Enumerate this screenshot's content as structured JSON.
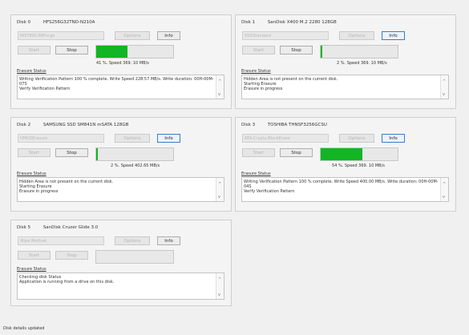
{
  "disks": [
    {
      "id": "0",
      "name": "HFS256G32TND-N210A",
      "method": "NIST800-88Purge",
      "options": "Options",
      "info": "Info",
      "start": "Start",
      "stop": "Stop",
      "progress": 41,
      "speed_text": "41 %. Speed  369. 10 MB/s",
      "status_label": "Erasure Status",
      "status_lines": [
        "Writing Verification Pattern 100 % complete. Write Speed  228.57 MB/s. Write duration: 00H-00M-07S",
        "Verify Verification Pattern",
        ""
      ],
      "scroll_up": "^",
      "scroll_down": "v"
    },
    {
      "id": "1",
      "name": "SanDisk X400 M.2 2280 128GB",
      "method": "SSDStandard",
      "options": "Options",
      "info": "Info",
      "start": "Start",
      "stop": "Stop",
      "progress": 2,
      "speed_text": "2 %. Speed  369. 10 MB/s",
      "status_label": "Erasure Status",
      "status_lines": [
        "Hidden Area is not present on the current disk.",
        "Starting Erasure",
        "Erasure in progress"
      ],
      "scroll_up": "^",
      "scroll_down": "v"
    },
    {
      "id": "2",
      "name": "SAMSUNG SSD SM841N mSATA 128GB",
      "method": "HMG5Erasure",
      "options": "Options",
      "info": "Info",
      "start": "Start",
      "stop": "Stop",
      "progress": 2,
      "speed_text": "2 %. Speed  402.65 MB/s",
      "status_label": "Erasure Status",
      "status_lines": [
        "Hidden Area is not present on the current disk.",
        "Starting Erasure",
        "Erasure in progress"
      ],
      "scroll_up": "^",
      "scroll_down": "v"
    },
    {
      "id": "3",
      "name": "TOSHIBA THNSF3256GCSU",
      "method": "ATA-Crypto-BlockErase",
      "options": "Options",
      "info": "Info",
      "start": "Start",
      "stop": "Stop",
      "progress": 54,
      "speed_text": "54 %. Speed  369. 10 MB/s",
      "status_label": "Erasure Status",
      "status_lines": [
        "Writing Verification Pattern 100 % complete. Write Speed  400.00 MB/s. Write duration: 00H-00M-04S",
        "Verify Verification Pattern",
        ""
      ],
      "scroll_up": "^",
      "scroll_down": "v"
    },
    {
      "id": "5",
      "name": "SanDisk Cruzer Glide 3.0",
      "method": "Wipe Method",
      "options": "Options",
      "info": "Info",
      "start": "Start",
      "stop": "Stop",
      "progress": 0,
      "speed_text": "",
      "status_label": "Erasure Status",
      "status_lines": [
        "Checking disk Status",
        "Application is running from a drive on this disk.",
        ""
      ],
      "scroll_up": "^",
      "scroll_down": "v"
    }
  ],
  "footer": "Disk details updated",
  "colors": {
    "progress_fill": "#12b524",
    "focus_border": "#2f7fd5"
  }
}
